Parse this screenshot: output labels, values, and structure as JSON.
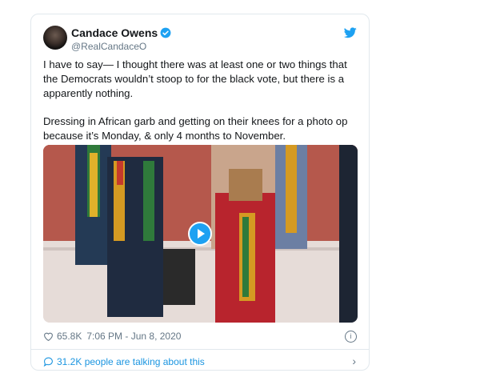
{
  "tweet": {
    "author_name": "Candace Owens",
    "author_handle": "@RealCandaceO",
    "paragraph_1": "I have to say— I thought there was at least one or two things that the Democrats wouldn’t stoop to for the black vote, but there is a apparently nothing.",
    "paragraph_2": "Dressing in African garb and getting on their knees for a photo op because it’s Monday, & only 4 months to November.",
    "likes": "65.8K",
    "timestamp": "7:06 PM - Jun 8, 2020",
    "talking": "31.2K people are talking about this"
  },
  "icons": {
    "verified": "verified-badge-icon",
    "bird": "twitter-bird-icon",
    "like": "heart-icon",
    "info": "info-icon",
    "comment": "comment-icon",
    "chevron": "chevron-right-icon",
    "play": "play-icon"
  },
  "colors": {
    "accent": "#1da1f2",
    "text": "#14171a",
    "secondary": "#657786",
    "border": "#e1e8ed"
  }
}
